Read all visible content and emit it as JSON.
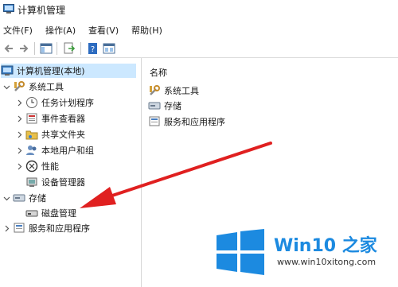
{
  "window": {
    "title": "计算机管理"
  },
  "menu": [
    "文件(F)",
    "操作(A)",
    "查看(V)",
    "帮助(H)"
  ],
  "toolbar": {
    "icons": [
      "back-icon",
      "forward-icon",
      "show-hide-tree-icon",
      "export-list-icon",
      "help-icon",
      "properties-icon"
    ]
  },
  "tree": {
    "root": "计算机管理(本地)",
    "system_tools": {
      "label": "系统工具",
      "children": [
        "任务计划程序",
        "事件查看器",
        "共享文件夹",
        "本地用户和组",
        "性能",
        "设备管理器"
      ]
    },
    "storage": {
      "label": "存储",
      "children": [
        "磁盘管理"
      ]
    },
    "services": "服务和应用程序"
  },
  "content": {
    "header": "名称",
    "items": [
      "系统工具",
      "存储",
      "服务和应用程序"
    ]
  },
  "annotation": {
    "color": "#e02020"
  },
  "watermark": {
    "brand": "Win10 之家",
    "url": "www.win10xitong.com",
    "color": "#1c8ae0"
  }
}
